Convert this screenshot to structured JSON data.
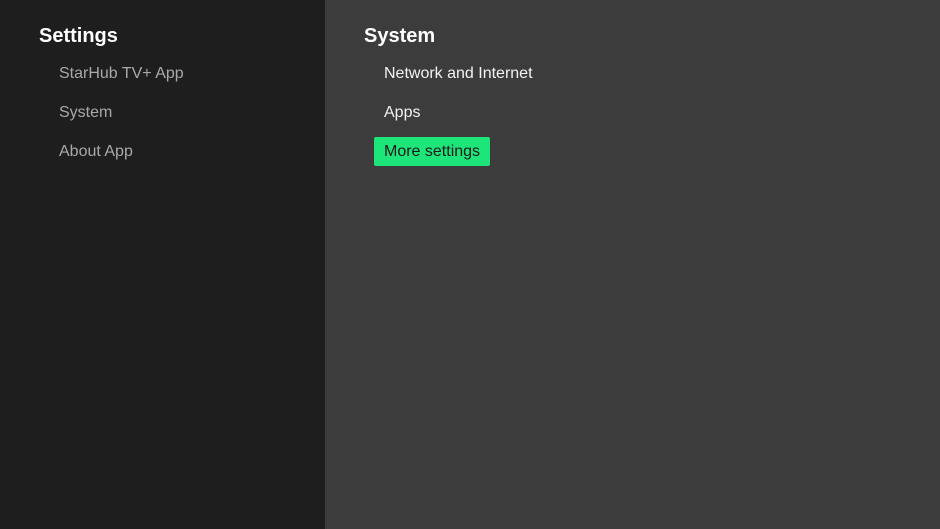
{
  "sidebar": {
    "title": "Settings",
    "items": [
      {
        "label": "StarHub TV+ App"
      },
      {
        "label": "System"
      },
      {
        "label": "About App"
      }
    ]
  },
  "main": {
    "title": "System",
    "items": [
      {
        "label": "Network and Internet"
      },
      {
        "label": "Apps"
      },
      {
        "label": "More settings",
        "focused": true
      }
    ]
  },
  "colors": {
    "sidebar_bg": "#1e1e1e",
    "main_bg": "#3c3c3c",
    "focus_accent": "#1ee57a"
  }
}
